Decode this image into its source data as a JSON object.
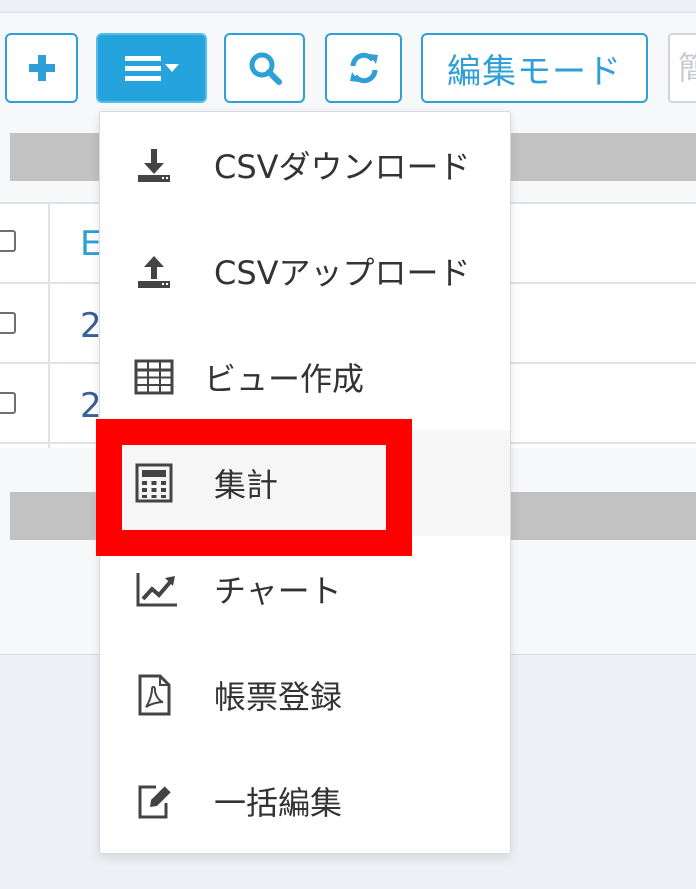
{
  "toolbar": {
    "edit_mode_label": "編集モード",
    "search_placeholder": "簡"
  },
  "grid": {
    "header_cell": "E",
    "rows": [
      {
        "text": "2"
      },
      {
        "text": "2"
      }
    ]
  },
  "menu": {
    "items": [
      {
        "label": "CSVダウンロード",
        "icon": "download-icon"
      },
      {
        "label": "CSVアップロード",
        "icon": "upload-icon"
      },
      {
        "label": "ビュー作成",
        "icon": "table-icon"
      },
      {
        "label": "集計",
        "icon": "calculator-icon"
      },
      {
        "label": "チャート",
        "icon": "line-chart-icon"
      },
      {
        "label": "帳票登録",
        "icon": "pdf-file-icon"
      },
      {
        "label": "一括編集",
        "icon": "edit-icon"
      }
    ]
  },
  "colors": {
    "accent": "#25a3dc",
    "highlight": "#ff0000"
  }
}
